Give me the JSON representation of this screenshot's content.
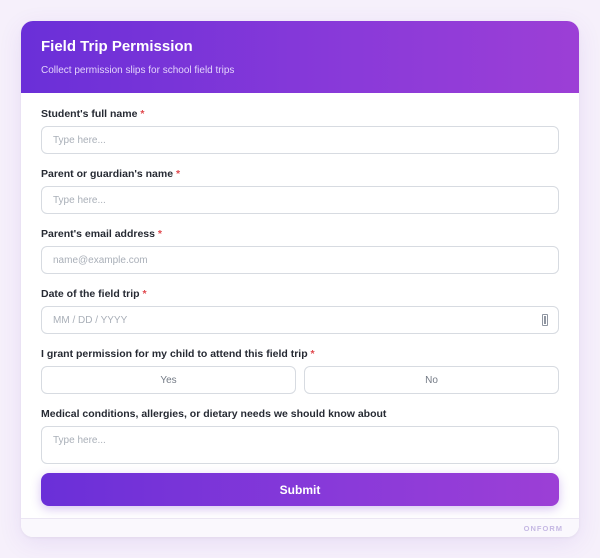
{
  "header": {
    "title": "Field Trip Permission",
    "subtitle": "Collect permission slips for school field trips"
  },
  "form": {
    "required_marker": "*",
    "fields": [
      {
        "label": "Student's full name",
        "placeholder": "Type here...",
        "value": ""
      },
      {
        "label": "Parent or guardian's name",
        "placeholder": "Type here...",
        "value": ""
      },
      {
        "label": "Parent's email address",
        "placeholder": "name@example.com",
        "value": ""
      },
      {
        "label": "Date of the field trip",
        "placeholder": "MM / DD / YYYY",
        "value": ""
      }
    ],
    "permission": {
      "label": "I grant permission for my child to attend this field trip",
      "options": [
        "Yes",
        "No"
      ],
      "selected": ""
    },
    "medical": {
      "label": "Medical conditions, allergies, or dietary needs we should know about",
      "placeholder": "Type here..."
    },
    "submit_label": "Submit"
  },
  "footer": {
    "brand": "ONFORM"
  },
  "colors": {
    "accent_start": "#6a2fd8",
    "accent_end": "#9c3fd6",
    "required": "#e0484d"
  },
  "icons": {
    "date_picker": "calendar-icon"
  }
}
